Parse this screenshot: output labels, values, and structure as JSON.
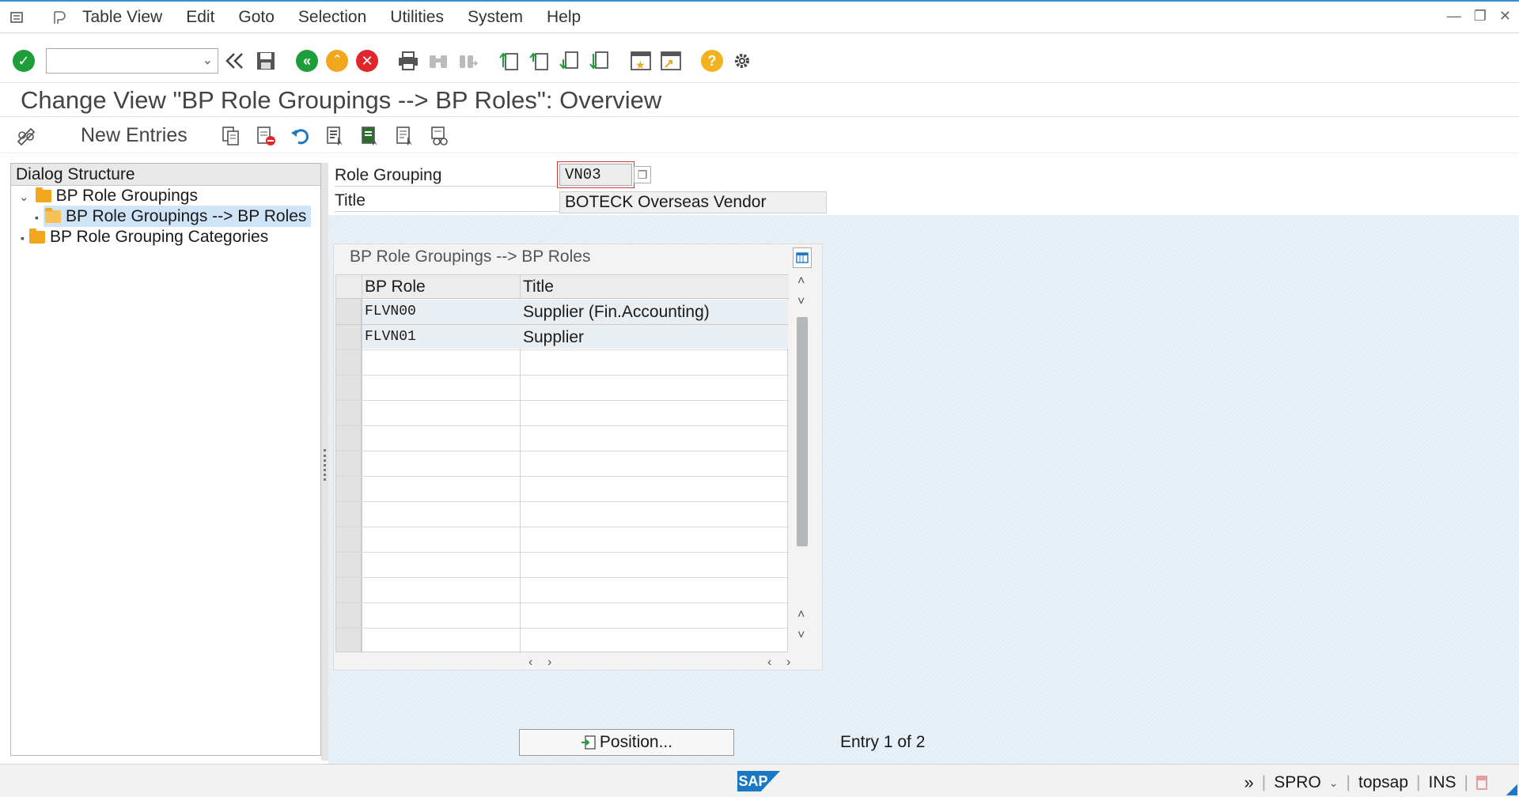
{
  "menu": {
    "items": [
      "Table View",
      "Edit",
      "Goto",
      "Selection",
      "Utilities",
      "System",
      "Help"
    ]
  },
  "toolbar": {
    "command_value": ""
  },
  "page": {
    "title": "Change View \"BP Role Groupings --> BP Roles\": Overview"
  },
  "app_toolbar": {
    "new_entries_label": "New Entries"
  },
  "dialog_structure": {
    "header": "Dialog Structure",
    "items": [
      {
        "label": "BP Role Groupings"
      },
      {
        "label": "BP Role Groupings --> BP Roles"
      },
      {
        "label": "BP Role Grouping Categories"
      }
    ]
  },
  "header_fields": {
    "role_grouping_label": "Role Grouping",
    "role_grouping_value": "VN03",
    "title_label": "Title",
    "title_value": "BOTECK Overseas Vendor"
  },
  "table": {
    "caption": "BP Role Groupings --> BP Roles",
    "columns": [
      "BP Role",
      "Title"
    ],
    "rows": [
      {
        "bp_role": "FLVN00",
        "title": "Supplier (Fin.Accounting)"
      },
      {
        "bp_role": "FLVN01",
        "title": "Supplier"
      }
    ]
  },
  "footer": {
    "position_button": "Position...",
    "entry_info": "Entry 1 of 2"
  },
  "status": {
    "logo": "SAP",
    "transaction": "SPRO",
    "system": "topsap",
    "mode": "INS"
  },
  "colors": {
    "accent_blue": "#1b78c4",
    "check_green": "#1e9e3a",
    "cancel_red": "#e0252b",
    "exit_orange": "#f2a61e",
    "help_yellow": "#f2b21e"
  }
}
